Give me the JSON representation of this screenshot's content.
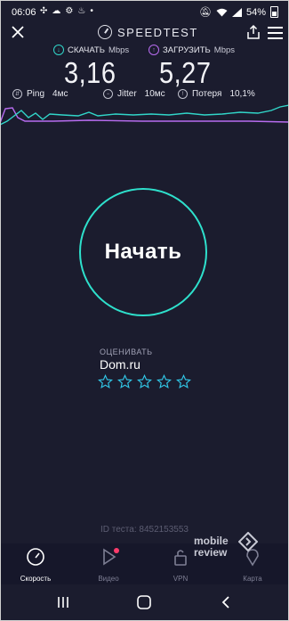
{
  "status_bar": {
    "time": "06:06",
    "battery": "54%"
  },
  "app": {
    "brand": "SPEEDTEST"
  },
  "download": {
    "label": "СКАЧАТЬ",
    "unit": "Mbps",
    "value": "3,16"
  },
  "upload": {
    "label": "ЗАГРУЗИТЬ",
    "unit": "Mbps",
    "value": "5,27"
  },
  "stats": {
    "ping_label": "Ping",
    "ping_value": "4мс",
    "jitter_label": "Jitter",
    "jitter_value": "10мс",
    "loss_label": "Потеря",
    "loss_value": "10,1%"
  },
  "start_button": "Начать",
  "rating": {
    "title": "ОЦЕНИВАТЬ",
    "provider": "Dom.ru",
    "stars_total": 5,
    "stars_filled": 0
  },
  "test_id": "ID теста: 8452153553",
  "nav": {
    "items": [
      {
        "label": "Скорость",
        "icon": "speedometer-icon",
        "active": true
      },
      {
        "label": "Видео",
        "icon": "play-icon",
        "active": false,
        "badge": true
      },
      {
        "label": "VPN",
        "icon": "lock-icon",
        "active": false
      },
      {
        "label": "Карта",
        "icon": "map-pin-icon",
        "active": false
      }
    ]
  },
  "watermark": {
    "line1": "mobile",
    "line2": "review"
  },
  "colors": {
    "background": "#1b1c2e",
    "download": "#31d6c9",
    "upload": "#b86cf0",
    "accent_ring": "#2ee0cc",
    "badge": "#ff3b6b"
  }
}
